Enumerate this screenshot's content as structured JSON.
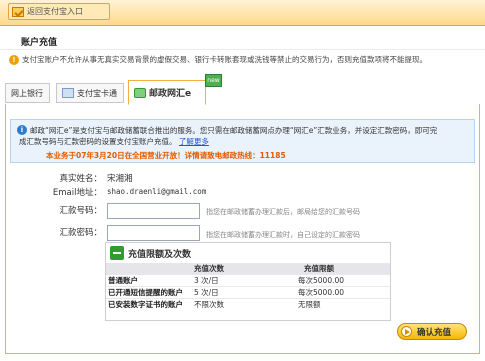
{
  "topbar": {
    "return_label": "返回支付宝入口"
  },
  "page": {
    "title": "账户充值"
  },
  "warning": {
    "icon": "warning-icon",
    "text": "支付宝账户不允许从事无真实交易背景的虚假交易、银行卡转账套现或洗钱等禁止的交易行为，否则充值款项将不能提现。"
  },
  "tabs": [
    {
      "label": "网上银行",
      "icon": "bank-icon"
    },
    {
      "label": "支付宝卡通",
      "icon": "card-icon"
    },
    {
      "label": "邮政网汇e",
      "icon": "postal-icon"
    }
  ],
  "tab_badge": "new",
  "notice": {
    "line1": "邮政“网汇e”是支付宝与邮政储蓄联合推出的服务。您只需在邮政储蓄网点办理“网汇e”汇款业务，并设定汇款密码，即可完",
    "line2": "成汇款号码与汇款密码的设置支付宝账户充值。",
    "link": "了解更多",
    "highlight": "本业务于07年3月20日在全国营业开放！详情请致电邮政热线：11185"
  },
  "form": {
    "realname_label": "真实姓名：",
    "realname_value": "宋湘湘",
    "email_label": "Email地址：",
    "email_value": "shao.draenli@gmail.com",
    "remit_no_label": "汇款号码：",
    "remit_no_hint": "指您在邮政储蓄办理汇款后，邮局给您的汇款号码",
    "remit_pw_label": "汇款密码：",
    "remit_pw_hint": "指您在邮政储蓄办理汇款时，自己设定的汇款密码"
  },
  "limits": {
    "title": "充值限额及次数",
    "columns": [
      "",
      "充值次数",
      "充值限额"
    ],
    "rows": [
      [
        "普通账户",
        "3 次/日",
        "每次5000.00"
      ],
      [
        "已开通短信提醒的账户",
        "5 次/日",
        "每次5000.00"
      ],
      [
        "已安装数字证书的账户",
        "不限次数",
        "无限额"
      ]
    ]
  },
  "confirm_button": "确认充值",
  "colors": {
    "accent": "#f0b040",
    "topbar": "#ffd98a",
    "notice_bg": "#eaf3fb",
    "highlight": "#e05a00"
  }
}
